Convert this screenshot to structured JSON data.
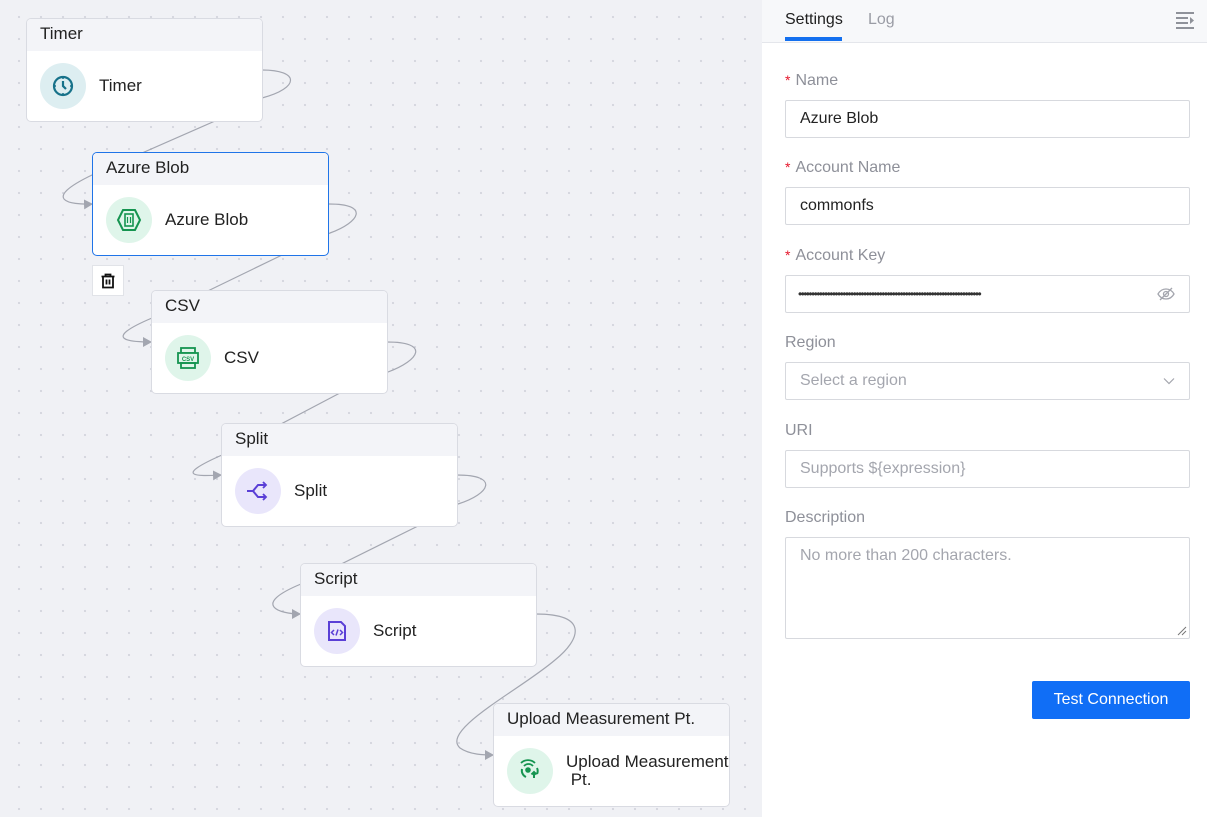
{
  "canvas": {
    "nodes": [
      {
        "id": "timer",
        "header": "Timer",
        "label": "Timer",
        "icon": "clock-icon",
        "icon_bg": "#ddeef1",
        "icon_color": "#17728a",
        "selected": false
      },
      {
        "id": "azure-blob",
        "header": "Azure Blob",
        "label": "Azure Blob",
        "icon": "azure-blob-icon",
        "icon_bg": "#dff5ea",
        "icon_color": "#159450",
        "selected": true
      },
      {
        "id": "csv",
        "header": "CSV",
        "label": "CSV",
        "icon": "csv-icon",
        "icon_bg": "#dff5ea",
        "icon_color": "#159450",
        "selected": false
      },
      {
        "id": "split",
        "header": "Split",
        "label": "Split",
        "icon": "split-icon",
        "icon_bg": "#e9e6fb",
        "icon_color": "#5a3fd6",
        "selected": false
      },
      {
        "id": "script",
        "header": "Script",
        "label": "Script",
        "icon": "script-icon",
        "icon_bg": "#e9e6fb",
        "icon_color": "#5a3fd6",
        "selected": false
      },
      {
        "id": "upload",
        "header": "Upload Measurement Pt.",
        "label_line1": "Upload Measurement",
        "label_line2": " Pt.",
        "icon": "upload-measurement-icon",
        "icon_bg": "#dff5ea",
        "icon_color": "#159450",
        "selected": false
      }
    ],
    "icon_text": {
      "csv": "CSV"
    }
  },
  "panel": {
    "tabs": [
      {
        "label": "Settings",
        "active": true
      },
      {
        "label": "Log",
        "active": false
      }
    ],
    "form": {
      "name": {
        "label": "Name",
        "required": true,
        "value": "Azure Blob"
      },
      "account_name": {
        "label": "Account Name",
        "required": true,
        "value": "commonfs"
      },
      "account_key": {
        "label": "Account Key",
        "required": true,
        "value": "••••••••••••••••••••••••••••••••••••••••••••••••••••••••••••••••••••••"
      },
      "region": {
        "label": "Region",
        "required": false,
        "placeholder": "Select a region"
      },
      "uri": {
        "label": "URI",
        "required": false,
        "placeholder": "Supports ${expression}"
      },
      "description": {
        "label": "Description",
        "required": false,
        "placeholder": "No more than 200 characters."
      }
    },
    "required_mark": "*",
    "test_button": "Test Connection",
    "accent_color": "#106ef6"
  }
}
